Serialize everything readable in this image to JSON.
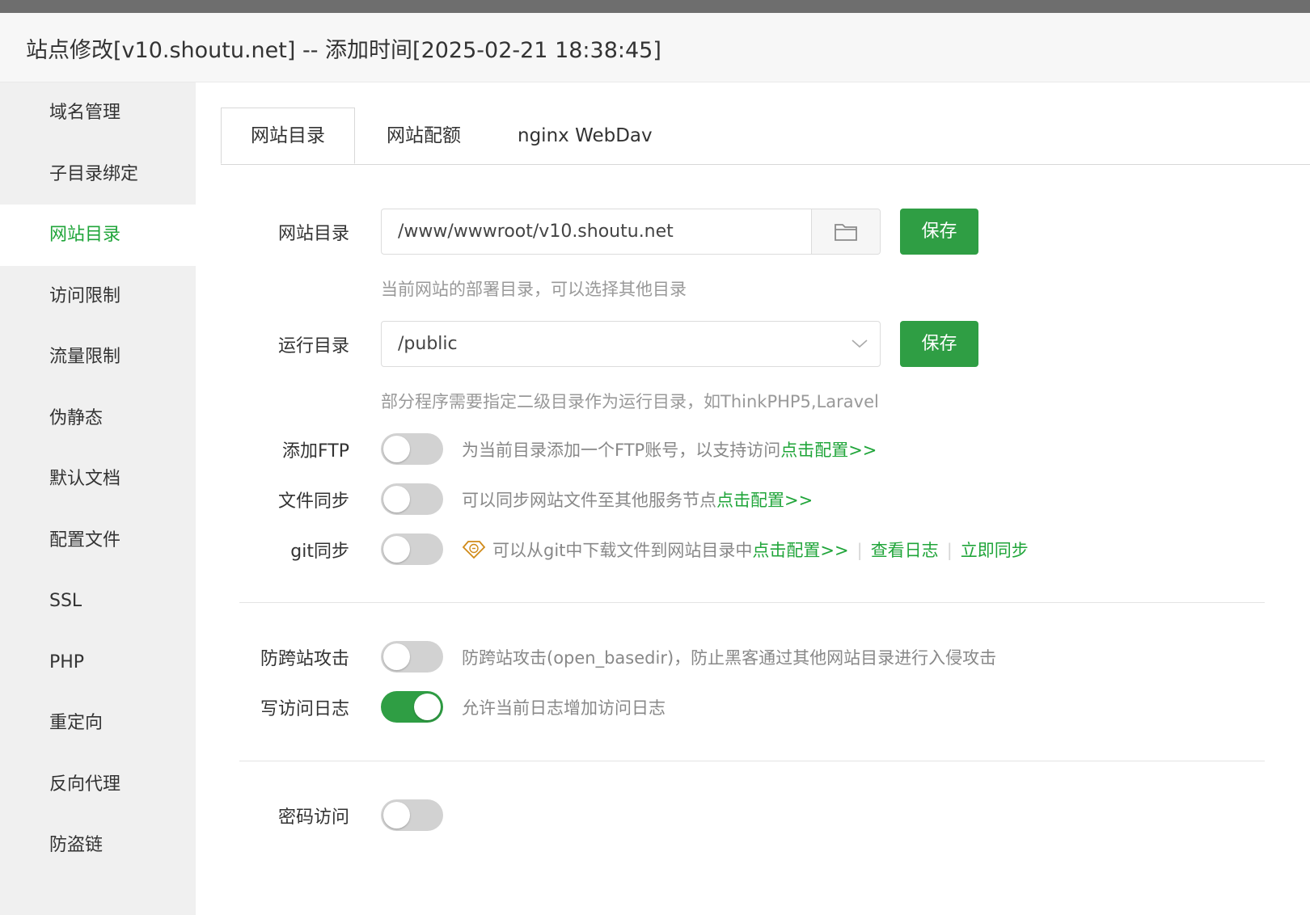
{
  "window": {
    "title": "站点修改[v10.shoutu.net] -- 添加时间[2025-02-21 18:38:45]"
  },
  "sidebar": {
    "items": [
      {
        "label": "域名管理"
      },
      {
        "label": "子目录绑定"
      },
      {
        "label": "网站目录",
        "active": true
      },
      {
        "label": "访问限制"
      },
      {
        "label": "流量限制"
      },
      {
        "label": "伪静态"
      },
      {
        "label": "默认文档"
      },
      {
        "label": "配置文件"
      },
      {
        "label": "SSL"
      },
      {
        "label": "PHP"
      },
      {
        "label": "重定向"
      },
      {
        "label": "反向代理"
      },
      {
        "label": "防盗链"
      }
    ]
  },
  "tabs": [
    {
      "label": "网站目录",
      "active": true
    },
    {
      "label": "网站配额"
    },
    {
      "label": "nginx WebDav"
    }
  ],
  "site_dir": {
    "label": "网站目录",
    "value": "/www/wwwroot/v10.shoutu.net",
    "folder_icon": "folder-icon",
    "save_label": "保存",
    "hint": "当前网站的部署目录，可以选择其他目录"
  },
  "run_dir": {
    "label": "运行目录",
    "selected": "/public",
    "save_label": "保存",
    "hint": "部分程序需要指定二级目录作为运行目录，如ThinkPHP5,Laravel"
  },
  "ftp": {
    "label": "添加FTP",
    "enabled": false,
    "desc": "为当前目录添加一个FTP账号，以支持访问",
    "link": "点击配置>>"
  },
  "file_sync": {
    "label": "文件同步",
    "enabled": false,
    "desc": "可以同步网站文件至其他服务节点",
    "link": "点击配置>>"
  },
  "git_sync": {
    "label": "git同步",
    "enabled": false,
    "icon": "enterprise-gem-icon",
    "desc": "可以从git中下载文件到网站目录中",
    "link": "点击配置>>",
    "log_link": "查看日志",
    "sync_link": "立即同步",
    "separator": "|"
  },
  "anti_xss": {
    "label": "防跨站攻击",
    "enabled": false,
    "desc": "防跨站攻击(open_basedir)，防止黑客通过其他网站目录进行入侵攻击"
  },
  "access_log": {
    "label": "写访问日志",
    "enabled": true,
    "desc": "允许当前日志增加访问日志"
  },
  "password_access": {
    "label": "密码访问",
    "enabled": false
  },
  "colors": {
    "accent": "#20a53a",
    "button": "#2f9e44",
    "switch_off": "#d2d2d2"
  }
}
